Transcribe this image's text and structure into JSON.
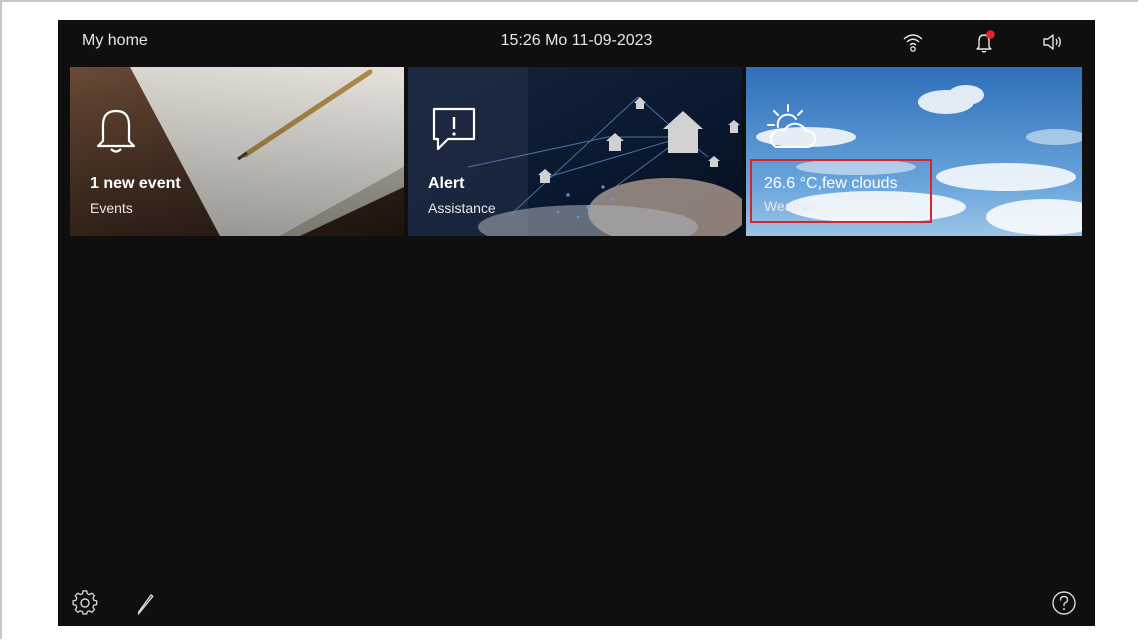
{
  "header": {
    "title": "My home",
    "datetime": "15:26  Mo 11-09-2023"
  },
  "tiles": [
    {
      "main": "1 new event",
      "sub": "Events",
      "icon": "bell-icon"
    },
    {
      "main": "Alert",
      "sub": "Assistance",
      "icon": "alert-speech-bubble-icon"
    },
    {
      "main": "26.6 °C,few clouds",
      "sub": "Weather",
      "icon": "partly-cloudy-icon"
    }
  ],
  "status_icons": [
    "wifi-icon",
    "notification-bell-icon",
    "speaker-icon"
  ],
  "footer_icons": [
    "settings-gear-icon",
    "edit-pencil-icon",
    "help-icon"
  ],
  "colors": {
    "background": "#0f0f0f",
    "notification_dot": "#e4252b",
    "highlight": "#d9232d"
  }
}
